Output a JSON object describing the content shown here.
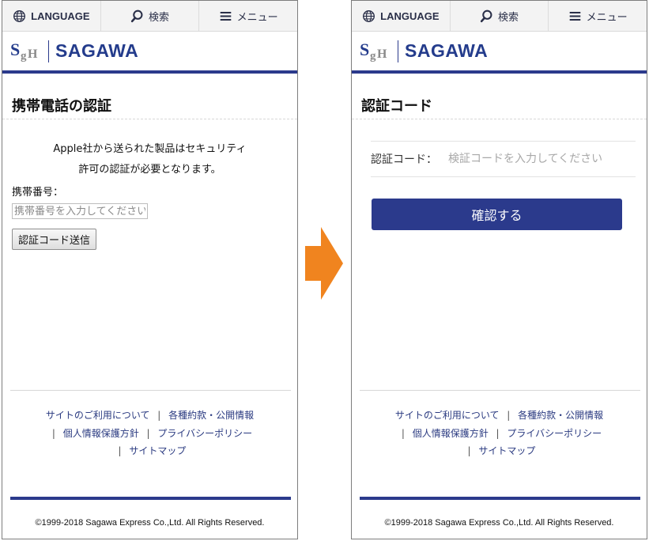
{
  "nav": {
    "language": "LANGUAGE",
    "search": "検索",
    "menu": "メニュー"
  },
  "logo": {
    "mark": "SgH",
    "text": "SAGAWA"
  },
  "left": {
    "title": "携帯電話の認証",
    "intro_line1": "Apple社から送られた製品はセキュリティ",
    "intro_line2": "許可の認証が必要となります。",
    "phone_label": "携帯番号：",
    "phone_placeholder": "携帯番号を入力してください",
    "send_button": "認証コード送信"
  },
  "right": {
    "title": "認証コード",
    "code_label": "認証コード：",
    "code_placeholder": "検証コードを入力してください",
    "confirm_button": "確認する"
  },
  "footer": {
    "link_terms_site": "サイトのご利用について",
    "link_agreements": "各種約款・公開情報",
    "link_privacy_policy": "個人情報保護方針",
    "link_privacy": "プライバシーポリシー",
    "link_sitemap": "サイトマップ",
    "copyright": "©1999-2018 Sagawa Express Co.,Ltd. All Rights Reserved."
  },
  "colors": {
    "brand_blue": "#2b3a8c",
    "arrow_orange": "#f0841f"
  },
  "icons": [
    "globe-icon",
    "search-icon",
    "menu-icon",
    "arrow-right-icon"
  ]
}
